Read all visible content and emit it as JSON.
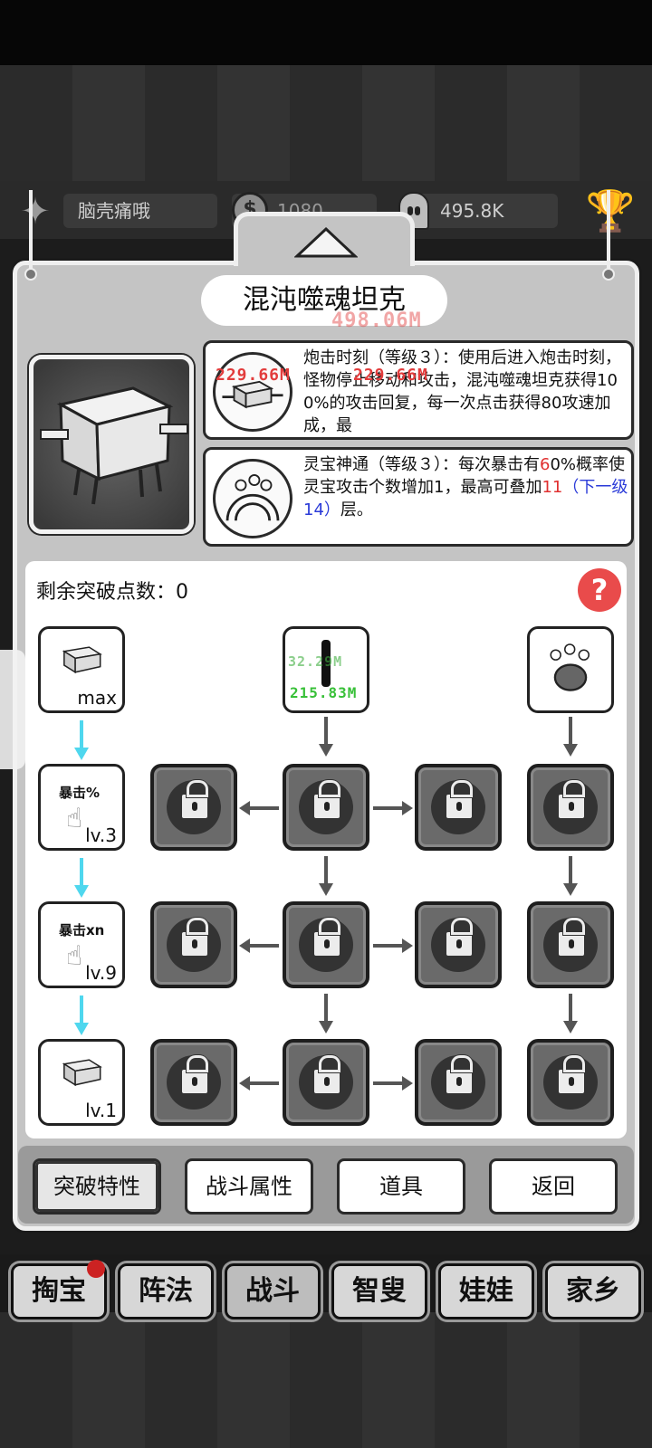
{
  "header": {
    "player_name": "脑壳痛哦",
    "gold": "1080",
    "souls": "495.8K"
  },
  "hero": {
    "name": "混沌噬魂坦克"
  },
  "floating_damage": [
    "229.66M",
    "229.66M",
    "498.06M"
  ],
  "skills": [
    {
      "icon": "cannon-skill-icon",
      "segments": [
        "炮击时刻（等级３）：使用后进入炮击时刻，怪物停止移动和攻击，混沌噬魂坦克获得100%的攻击回复，每一次点击获得80攻速加成，最"
      ]
    },
    {
      "icon": "spirit-treasure-skill-icon",
      "text_a": "灵宝神通（等级３）：每次暴击有",
      "text_b": "6",
      "text_c": "0%概率使灵宝攻击个数增加1，最高可叠加",
      "text_d": "11",
      "text_e": "（下一级14）",
      "text_f": "层。"
    }
  ],
  "tree": {
    "points_label": "剩余突破点数：",
    "points_value": "0",
    "help_label": "?",
    "left_column": [
      {
        "caption": "",
        "level": "max"
      },
      {
        "caption": "暴击%",
        "level": "lv.3"
      },
      {
        "caption": "暴击xn",
        "level": "lv.9"
      },
      {
        "caption": "",
        "level": "lv.1"
      }
    ],
    "center_top_damage": [
      "32.29M",
      "215.83M"
    ]
  },
  "panel_buttons": [
    "突破特性",
    "战斗属性",
    "道具",
    "返回"
  ],
  "bottom_nav": [
    "掏宝",
    "阵法",
    "战斗",
    "智叟",
    "娃娃",
    "家乡"
  ],
  "colors": {
    "accent_red": "#e94b4b",
    "arrow_cyan": "#4fd7ee",
    "blue_text": "#2a3ad8"
  }
}
